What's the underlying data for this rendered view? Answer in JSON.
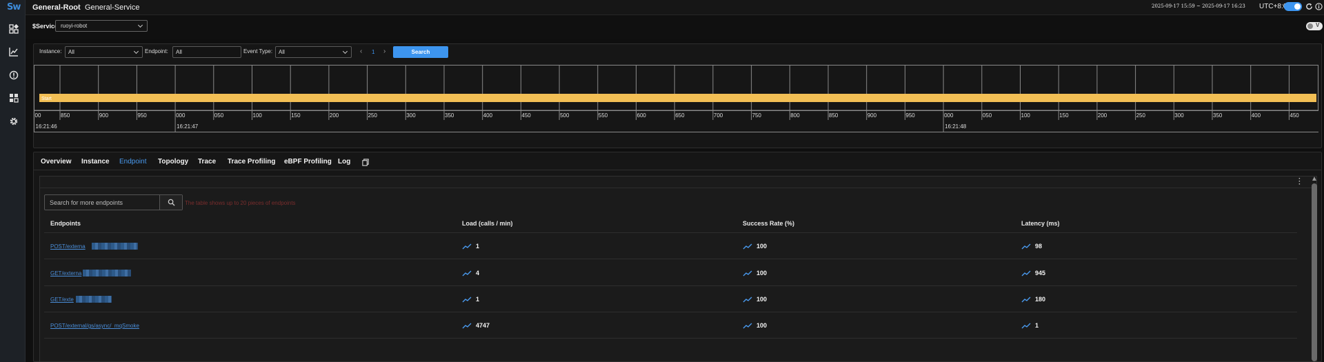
{
  "app": {
    "logo": "Sw"
  },
  "sidebar": {
    "items": [
      {
        "icon": "dashboard-icon"
      },
      {
        "icon": "chart-icon"
      },
      {
        "icon": "alert-icon"
      },
      {
        "icon": "widgets-icon"
      },
      {
        "icon": "gear-icon"
      }
    ]
  },
  "breadcrumb": {
    "root": "General-Root",
    "service": "General-Service"
  },
  "header": {
    "time_range": "2025-09-17 15:59 ~ 2025-09-17 16:23",
    "timezone": "UTC+8:0"
  },
  "service_selector": {
    "label": "$Service",
    "value": "ruoyi-robot"
  },
  "filters": {
    "instance_label": "Instance:",
    "instance_value": "All",
    "endpoint_label": "Endpoint:",
    "endpoint_value": "All",
    "event_type_label": "Event Type:",
    "event_type_value": "All",
    "page": "1",
    "search_label": "Search"
  },
  "timeline": {
    "event_label": "Start",
    "ticks": [
      "00",
      "850",
      "900",
      "950",
      "000",
      "050",
      "100",
      "150",
      "200",
      "250",
      "300",
      "350",
      "400",
      "450",
      "500",
      "550",
      "600",
      "650",
      "700",
      "750",
      "800",
      "850",
      "900",
      "950",
      "000",
      "050",
      "100",
      "150",
      "200",
      "250",
      "300",
      "350",
      "400",
      "450"
    ],
    "time_labels": [
      {
        "text": "16:21:46",
        "tick": 0
      },
      {
        "text": "16:21:47",
        "tick": 4
      },
      {
        "text": "16:21:48",
        "tick": 24
      }
    ]
  },
  "tabs": [
    {
      "label": "Overview"
    },
    {
      "label": "Instance"
    },
    {
      "label": "Endpoint",
      "active": true
    },
    {
      "label": "Topology"
    },
    {
      "label": "Trace"
    },
    {
      "label": "Trace Profiling"
    },
    {
      "label": "eBPF Profiling"
    },
    {
      "label": "Log"
    }
  ],
  "endpoints": {
    "search_placeholder": "Search for more endpoints",
    "note": "The table shows up to 20 pieces of endpoints",
    "columns": [
      "Endpoints",
      "Load (calls / min)",
      "Success Rate (%)",
      "Latency (ms)"
    ],
    "rows": [
      {
        "name": "POST/externa",
        "load": "1",
        "success": "100",
        "latency": "98"
      },
      {
        "name": "GET/externa",
        "load": "4",
        "success": "100",
        "latency": "945"
      },
      {
        "name": "GET/exte",
        "load": "1",
        "success": "100",
        "latency": "180"
      },
      {
        "name": "POST/external/gs/async/_mqSmoke",
        "load": "4747",
        "success": "100",
        "latency": "1"
      }
    ]
  },
  "colors": {
    "accent": "#3d95ef",
    "event_bar": "#f2bf55",
    "link": "#4a8dd8"
  }
}
